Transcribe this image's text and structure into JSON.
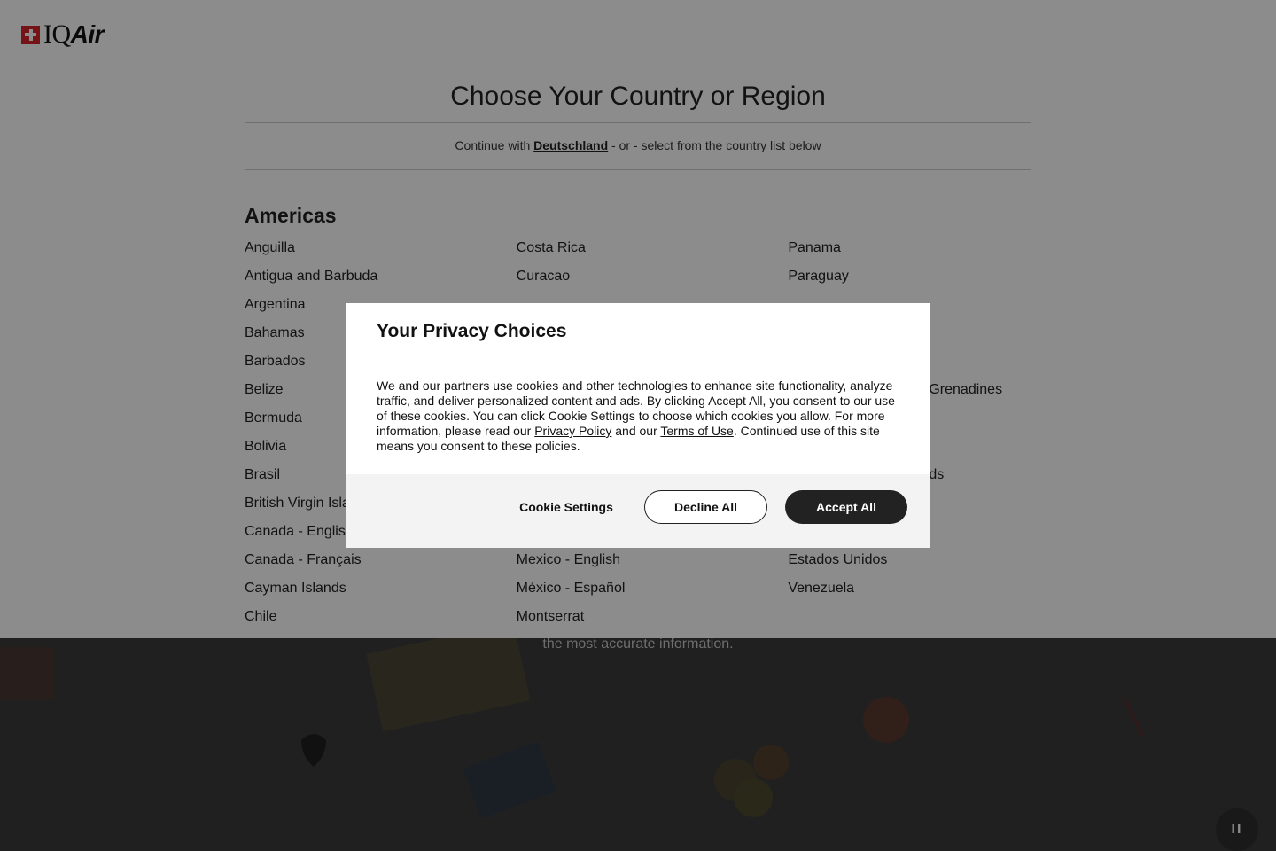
{
  "header": {
    "logo_text": "IQAir",
    "title": "Choose Your Country or Region",
    "continue_prefix": "Continue with",
    "continue_country": "Deutschland",
    "continue_suffix": "- or - select from the country list below"
  },
  "region": {
    "name": "Americas",
    "columns": [
      [
        "Anguilla",
        "Antigua and Barbuda",
        "Argentina",
        "Bahamas",
        "Barbados",
        "Belize",
        "Bermuda",
        "Bolivia",
        "Brasil",
        "British Virgin Isla",
        "Canada - Englis",
        "Canada - Français",
        "Cayman Islands",
        "Chile"
      ],
      [
        "Costa Rica",
        "Curacao",
        "",
        "",
        "",
        "",
        "",
        "",
        "",
        "",
        "",
        "Mexico - English",
        "México - Español",
        "Montserrat"
      ],
      [
        "Panama",
        "Paraguay",
        "",
        "",
        "",
        "Grenadines",
        "",
        "",
        "ds",
        "",
        "",
        "Estados Unidos",
        "Venezuela",
        ""
      ]
    ]
  },
  "hero": {
    "caption": "the most accurate information."
  },
  "pause_label": "II",
  "modal": {
    "title": "Your Privacy Choices",
    "body_1": "We and our partners use cookies and other technologies to enhance site functionality, analyze traffic, and deliver personalized content and ads. By clicking Accept All, you consent to our use of these cookies. You can click Cookie Settings to choose which cookies you allow. For more information, please read our",
    "privacy_link": "Privacy Policy",
    "body_2": "and our",
    "terms_link": "Terms of Use",
    "body_3": ". Continued use of this site means you consent to these policies.",
    "cookie_settings": "Cookie Settings",
    "decline_all": "Decline All",
    "accept_all": "Accept All"
  }
}
